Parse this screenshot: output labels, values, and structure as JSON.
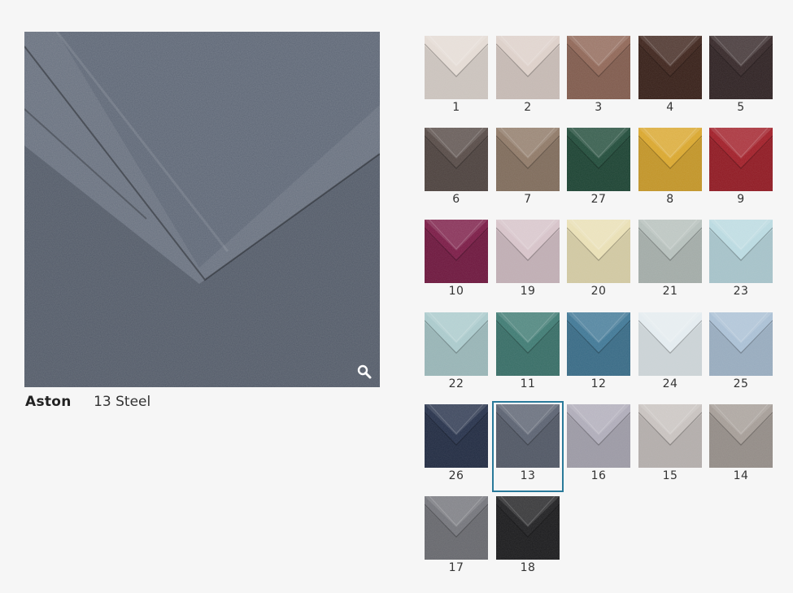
{
  "product": {
    "name": "Aston",
    "selected_variant": "13 Steel",
    "selected_code": "13",
    "main_color": "#5d6675"
  },
  "zoom_icon": "search-icon",
  "swatches": [
    {
      "code": "1",
      "color": "#e3dad3"
    },
    {
      "code": "2",
      "color": "#dccfc8"
    },
    {
      "code": "3",
      "color": "#8f6656"
    },
    {
      "code": "4",
      "color": "#3e241c"
    },
    {
      "code": "5",
      "color": "#352728"
    },
    {
      "code": "6",
      "color": "#564a46"
    },
    {
      "code": "7",
      "color": "#8e7866"
    },
    {
      "code": "27",
      "color": "#204b39"
    },
    {
      "code": "8",
      "color": "#d9a62c"
    },
    {
      "code": "9",
      "color": "#a01d27"
    },
    {
      "code": "10",
      "color": "#7a1a45"
    },
    {
      "code": "19",
      "color": "#d6c2c8"
    },
    {
      "code": "20",
      "color": "#e9dfb4"
    },
    {
      "code": "21",
      "color": "#b5bfbb"
    },
    {
      "code": "23",
      "color": "#b9d9e0"
    },
    {
      "code": "22",
      "color": "#a9c9cb"
    },
    {
      "code": "11",
      "color": "#3e7a72"
    },
    {
      "code": "12",
      "color": "#3f7795"
    },
    {
      "code": "24",
      "color": "#e3ebef"
    },
    {
      "code": "25",
      "color": "#a9bfd4"
    },
    {
      "code": "26",
      "color": "#26314a"
    },
    {
      "code": "13",
      "color": "#5a6170"
    },
    {
      "code": "16",
      "color": "#aeabb8"
    },
    {
      "code": "15",
      "color": "#c7c1be"
    },
    {
      "code": "14",
      "color": "#a49c96"
    },
    {
      "code": "17",
      "color": "#73747a"
    },
    {
      "code": "18",
      "color": "#1f1f21"
    }
  ]
}
